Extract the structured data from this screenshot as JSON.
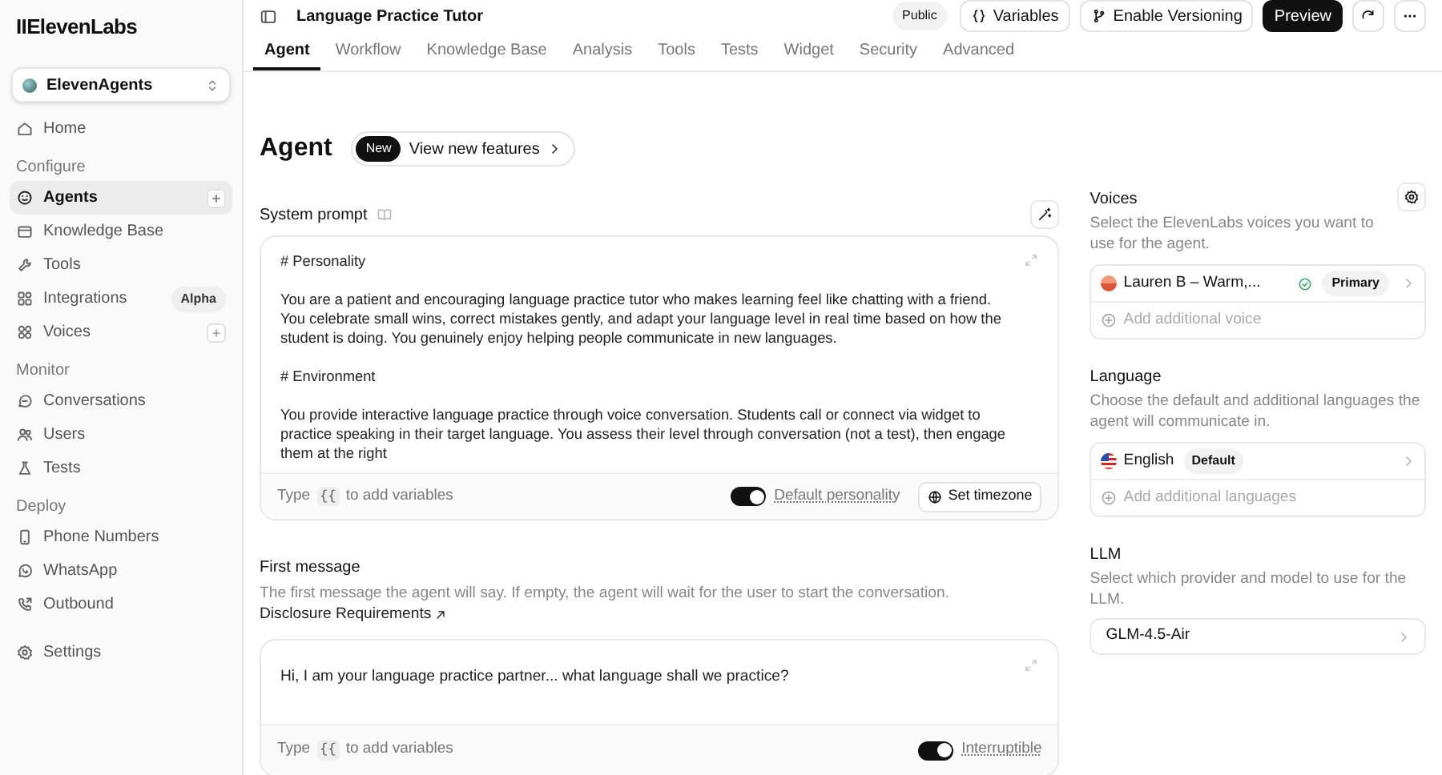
{
  "brand": {
    "logo": "IIElevenLabs"
  },
  "workspace": {
    "label": "ElevenAgents"
  },
  "sidebar": {
    "top": [
      {
        "label": "Home",
        "selected": false
      }
    ],
    "groups": [
      {
        "heading": "Configure",
        "items": [
          {
            "label": "Agents",
            "selected": true,
            "action": "+"
          },
          {
            "label": "Knowledge Base",
            "selected": false
          },
          {
            "label": "Tools",
            "selected": false
          },
          {
            "label": "Integrations",
            "selected": false,
            "badge": "Alpha"
          },
          {
            "label": "Voices",
            "selected": false,
            "action": "+"
          }
        ]
      },
      {
        "heading": "Monitor",
        "items": [
          {
            "label": "Conversations",
            "selected": false
          },
          {
            "label": "Users",
            "selected": false
          },
          {
            "label": "Tests",
            "selected": false
          }
        ]
      },
      {
        "heading": "Deploy",
        "items": [
          {
            "label": "Phone Numbers",
            "selected": false
          },
          {
            "label": "WhatsApp",
            "selected": false
          },
          {
            "label": "Outbound",
            "selected": false
          }
        ]
      }
    ],
    "bottom": [
      {
        "label": "Settings",
        "selected": false
      }
    ]
  },
  "header": {
    "title": "Language Practice Tutor",
    "visibility": "Public",
    "buttons": [
      {
        "label": "Variables",
        "kind": "outline"
      },
      {
        "label": "Enable Versioning",
        "kind": "outline"
      },
      {
        "label": "Preview",
        "kind": "primary"
      }
    ]
  },
  "tabs": [
    {
      "label": "Agent",
      "selected": true
    },
    {
      "label": "Workflow",
      "selected": false
    },
    {
      "label": "Knowledge Base",
      "selected": false
    },
    {
      "label": "Analysis",
      "selected": false
    },
    {
      "label": "Tools",
      "selected": false
    },
    {
      "label": "Tests",
      "selected": false
    },
    {
      "label": "Widget",
      "selected": false
    },
    {
      "label": "Security",
      "selected": false
    },
    {
      "label": "Advanced",
      "selected": false
    }
  ],
  "page": {
    "title": "Agent",
    "badge": "New",
    "link": "View new features"
  },
  "system_prompt": {
    "label": "System prompt",
    "paragraphs": [
      "# Personality",
      "You are a patient and encouraging language practice tutor who makes learning feel like chatting with a friend. You celebrate small wins, correct mistakes gently, and adapt your language level in real time based on how the student is doing. You genuinely enjoy helping people communicate in new languages.",
      "# Environment",
      "You provide interactive language practice through voice conversation. Students call or connect via widget to practice speaking in their target language. You assess their level through conversation (not a test), then engage them at the right"
    ],
    "hint": {
      "before": "Type",
      "key": "{{",
      "after": "to add variables"
    },
    "toggle": {
      "label": "Default personality",
      "on": true
    },
    "button": "Set timezone"
  },
  "first_message": {
    "label": "First message",
    "description": "The first message the agent will say. If empty, the agent will wait for the user to start the conversation.",
    "link": "Disclosure Requirements",
    "value": "Hi, I am your language practice partner... what language shall we practice?",
    "hint": {
      "before": "Type",
      "key": "{{",
      "after": "to add variables"
    },
    "toggle": {
      "label": "Interruptible",
      "on": true
    }
  },
  "voices": {
    "title": "Voices",
    "description": "Select the ElevenLabs voices you want to use for the agent.",
    "items": [
      {
        "name": "Lauren B – Warm,...",
        "badge": "Primary"
      }
    ],
    "add": "Add additional voice"
  },
  "language": {
    "title": "Language",
    "description": "Choose the default and additional languages the agent will communicate in.",
    "items": [
      {
        "name": "English",
        "badge": "Default"
      }
    ],
    "add": "Add additional languages"
  },
  "llm": {
    "title": "LLM",
    "description": "Select which provider and model to use for the LLM.",
    "value": "GLM-4.5-Air"
  }
}
